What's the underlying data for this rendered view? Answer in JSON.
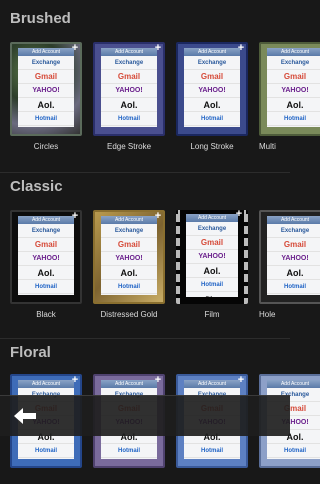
{
  "sections": [
    {
      "title": "Brushed",
      "items": [
        {
          "name": "Circles"
        },
        {
          "name": "Edge Stroke"
        },
        {
          "name": "Long Stroke"
        },
        {
          "name": "Multi"
        }
      ]
    },
    {
      "title": "Classic",
      "items": [
        {
          "name": "Black"
        },
        {
          "name": "Distressed Gold"
        },
        {
          "name": "Film"
        },
        {
          "name": "Hole"
        }
      ]
    },
    {
      "title": "Floral",
      "items": [
        {
          "name": ""
        },
        {
          "name": ""
        },
        {
          "name": ""
        },
        {
          "name": ""
        }
      ]
    }
  ],
  "thumbnail": {
    "header": "Add Account",
    "plus": "+",
    "logos": [
      "Exchange",
      "Gmail",
      "YAHOO!",
      "Aol.",
      "Hotmail",
      "Other"
    ]
  },
  "toolbar": {
    "back_icon": "back-arrow-icon"
  },
  "colors": {
    "background": "#181818",
    "section_title": "#bdbdbd",
    "caption": "#dcdcdc"
  }
}
